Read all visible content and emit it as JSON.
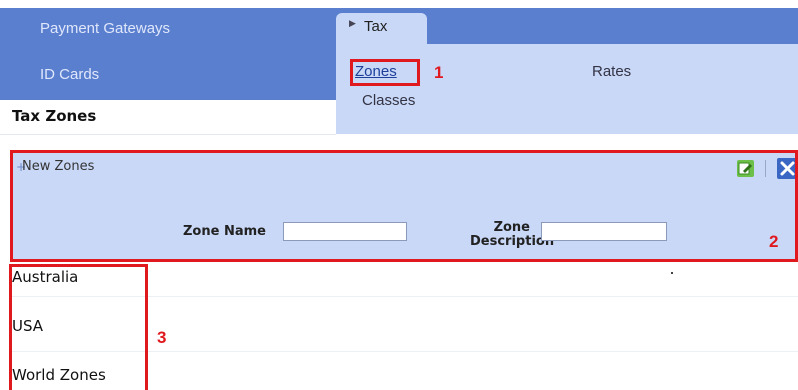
{
  "nav": {
    "items": [
      {
        "label": "Payment Gateways"
      },
      {
        "label": "ID Cards"
      }
    ]
  },
  "tax": {
    "tab_label": "Tax",
    "links": {
      "zones": "Zones",
      "rates": "Rates",
      "classes": "Classes"
    }
  },
  "page": {
    "heading": "Tax Zones"
  },
  "new_zones": {
    "title": "New Zones",
    "zone_name_label": "Zone Name",
    "zone_name_value": "",
    "zone_description_label": "Zone Description",
    "zone_description_value": ""
  },
  "zones_list": [
    {
      "name": "Australia"
    },
    {
      "name": "USA"
    },
    {
      "name": "World Zones"
    }
  ],
  "annotations": {
    "one": "1",
    "two": "2",
    "three": "3"
  },
  "colors": {
    "nav_blue": "#5b7fcf",
    "panel_light_blue": "#c9d8f7",
    "annotation_red": "#e0191f"
  },
  "icons": [
    "edit-icon",
    "close-icon",
    "plus-icon",
    "arrow-right-icon"
  ]
}
